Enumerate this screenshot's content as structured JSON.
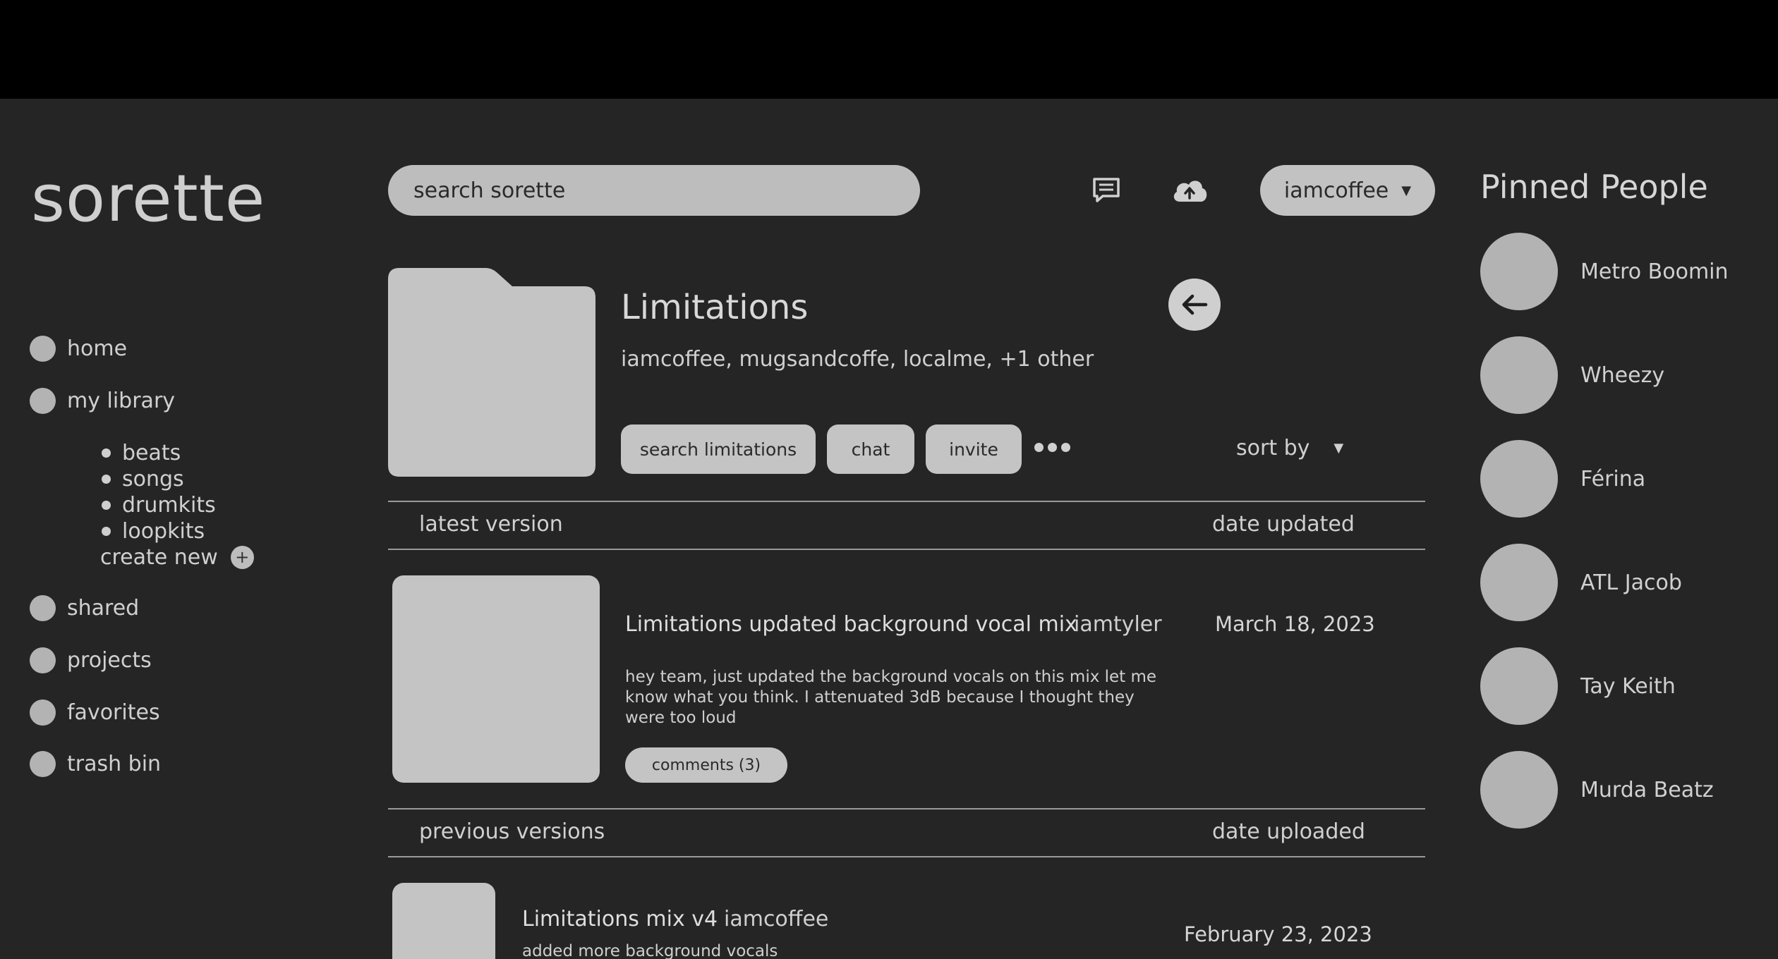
{
  "app": {
    "logo": "sorette"
  },
  "sidebar": {
    "items": [
      {
        "label": "home"
      },
      {
        "label": "my library"
      },
      {
        "label": "shared"
      },
      {
        "label": "projects"
      },
      {
        "label": "favorites"
      },
      {
        "label": "trash bin"
      }
    ],
    "library_sub": [
      "beats",
      "songs",
      "drumkits",
      "loopkits"
    ],
    "create_new": "create new"
  },
  "header": {
    "search_placeholder": "search sorette",
    "user": "iamcoffee"
  },
  "project": {
    "title": "Limitations",
    "members": "iamcoffee, mugsandcoffe, localme, +1 other",
    "buttons": {
      "search": "search limitations",
      "chat": "chat",
      "invite": "invite"
    },
    "sort_label": "sort by"
  },
  "latest": {
    "section_label": "latest version",
    "date_label": "date updated",
    "title": "Limitations updated background vocal mix",
    "author": "iamtyler",
    "date": "March 18, 2023",
    "description": "hey team, just updated the background vocals on this mix let me know what you think. I attenuated 3dB because I thought they were too loud",
    "comments": "comments (3)"
  },
  "previous": {
    "section_label": "previous versions",
    "date_label": "date uploaded",
    "items": [
      {
        "title": "Limitations mix v4",
        "author": "iamcoffee",
        "description": "added more background vocals",
        "date": "February 23, 2023"
      }
    ]
  },
  "pinned": {
    "title": "Pinned People",
    "people": [
      "Metro Boomin",
      "Wheezy",
      "Férina",
      "ATL Jacob",
      "Tay Keith",
      "Murda Beatz"
    ]
  },
  "icons": {
    "chat": "message-icon",
    "upload": "cloud-upload-icon",
    "back": "arrow-left-icon",
    "more": "more-dots-icon",
    "create": "plus-icon"
  }
}
